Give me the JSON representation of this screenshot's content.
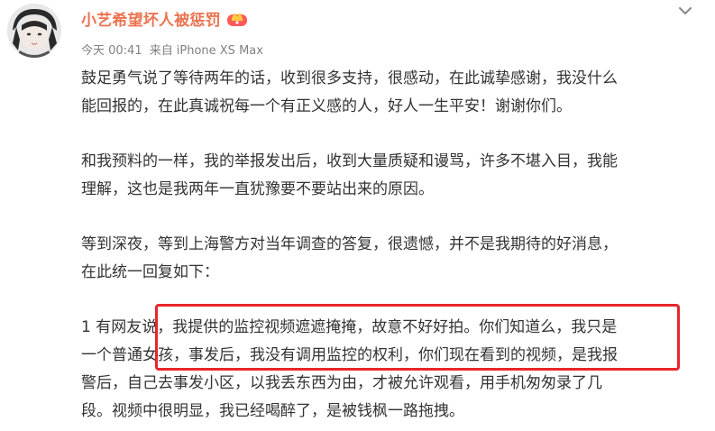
{
  "post": {
    "username": "小艺希望坏人被惩罚",
    "badge_icon": "crown-badge-icon",
    "time": "今天 00:41",
    "source_prefix": "来自",
    "source_device": "iPhone XS Max",
    "menu_icon": "chevron-down-icon",
    "accent_color": "#eb7350",
    "highlight_color": "#e8262c",
    "paragraphs": [
      {
        "lines": [
          "鼓足勇气说了等待两年的话，收到很多支持，很感动，在此诚挚感谢，我没什么",
          "能回报的，在此真诚祝每一个有正义感的人，好人一生平安！谢谢你们。"
        ]
      },
      {
        "lines": [
          "和我预料的一样，我的举报发出后，收到大量质疑和谩骂，许多不堪入目，我能",
          "理解，这也是我两年一直犹豫要不要站出来的原因。"
        ]
      },
      {
        "lines": [
          "等到深夜，等到上海警方对当年调查的答复，很遗憾，并不是我期待的好消息，",
          "在此统一回复如下："
        ]
      },
      {
        "lines": [
          "1 有网友说，我提供的监控视频遮遮掩掩，故意不好好拍。你们知道么，我只是",
          "一个普通女孩，事发后，我没有调用监控的权利，你们现在看到的视频，是我报",
          "警后，自己去事发小区，以我丢东西为由，才被允许观看，用手机匆匆录了几",
          "段。视频中很明显，我已经喝醉了，是被钱枫一路拖拽。"
        ]
      }
    ]
  }
}
